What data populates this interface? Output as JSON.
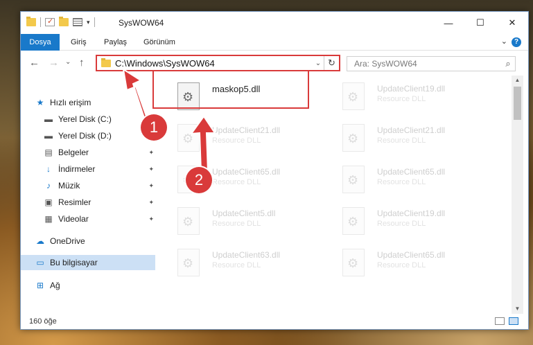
{
  "window": {
    "title": "SysWOW64",
    "controls": {
      "minimize": "—",
      "maximize": "☐",
      "close": "✕"
    }
  },
  "ribbon": {
    "tabs": [
      "Dosya",
      "Giriş",
      "Paylaş",
      "Görünüm"
    ],
    "help": "?"
  },
  "nav": {
    "back": "←",
    "forward": "→",
    "recent": "⌄",
    "up": "↑",
    "address": "C:\\Windows\\SysWOW64",
    "refresh": "↻",
    "search_placeholder": "Ara: SysWOW64",
    "search_icon": "⌕"
  },
  "sidebar": {
    "items": [
      {
        "label": "Hızlı erişim",
        "icon": "star-icon",
        "glyph": "★",
        "color": "#1979ca"
      },
      {
        "label": "Yerel Disk (C:)",
        "icon": "drive-icon",
        "glyph": "▬",
        "pinned": true
      },
      {
        "label": "Yerel Disk (D:)",
        "icon": "drive-icon",
        "glyph": "▬",
        "pinned": true
      },
      {
        "label": "Belgeler",
        "icon": "documents-icon",
        "glyph": "▤",
        "pinned": true
      },
      {
        "label": "İndirmeler",
        "icon": "download-icon",
        "glyph": "↓",
        "color": "#1979ca",
        "pinned": true
      },
      {
        "label": "Müzik",
        "icon": "music-icon",
        "glyph": "♪",
        "color": "#1979ca",
        "pinned": true
      },
      {
        "label": "Resimler",
        "icon": "pictures-icon",
        "glyph": "▣",
        "pinned": true
      },
      {
        "label": "Videolar",
        "icon": "videos-icon",
        "glyph": "▦",
        "pinned": true
      },
      {
        "label": "OneDrive",
        "icon": "cloud-icon",
        "glyph": "☁",
        "color": "#1979ca"
      },
      {
        "label": "Bu bilgisayar",
        "icon": "computer-icon",
        "glyph": "▭",
        "color": "#1979ca",
        "selected": true
      },
      {
        "label": "Ağ",
        "icon": "network-icon",
        "glyph": "⊞",
        "color": "#1979ca"
      }
    ],
    "pin_glyph": "📌"
  },
  "files": {
    "highlighted": {
      "name": "maskop5.dll"
    },
    "others": [
      {
        "name": "UpdateClient19.dll",
        "type": "Resource DLL"
      },
      {
        "name": "UpdateClient21.dll",
        "type": "Resource DLL"
      },
      {
        "name": "UpdateClient21.dll",
        "type": "Resource DLL"
      },
      {
        "name": "UpdateClient65.dll",
        "type": "Resource DLL"
      },
      {
        "name": "UpdateClient65.dll",
        "type": "Resource DLL"
      },
      {
        "name": "UpdateClient5.dll",
        "type": "Resource DLL"
      },
      {
        "name": "UpdateClient19.dll",
        "type": "Resource DLL"
      },
      {
        "name": "UpdateClient63.dll",
        "type": "Resource DLL"
      },
      {
        "name": "UpdateClient65.dll",
        "type": "Resource DLL"
      }
    ]
  },
  "status": {
    "count": "160 öğe"
  },
  "annotations": {
    "step1": "1",
    "step2": "2",
    "color": "#d93a3a"
  }
}
